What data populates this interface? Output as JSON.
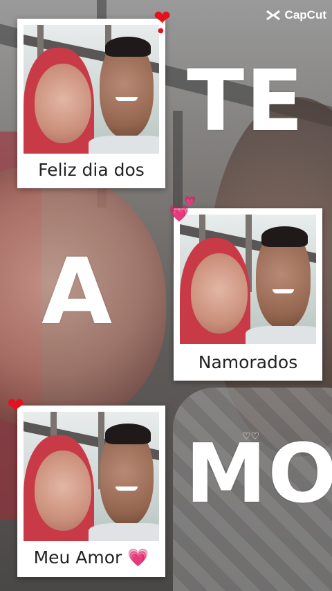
{
  "watermark": {
    "brand": "CapCut",
    "icon": "capcut-logo-icon"
  },
  "polaroids": [
    {
      "caption": "Feliz dia dos"
    },
    {
      "caption": "Namorados"
    },
    {
      "caption": "Meu Amor 💗"
    }
  ],
  "overlay_text": {
    "line1": "TE",
    "line2": "A",
    "line3": "MO"
  },
  "hearts": {
    "red": "❤",
    "pink": "💗"
  },
  "colors": {
    "heart_red": "#e4121f",
    "heart_pink": "#f03aa0",
    "card": "#ffffff",
    "text": "#222222"
  }
}
